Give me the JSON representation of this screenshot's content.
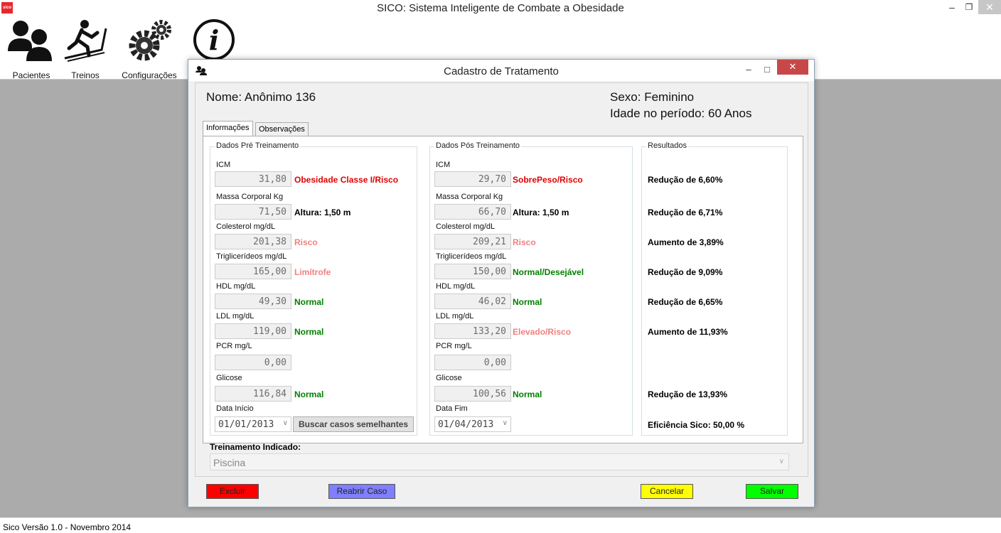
{
  "app": {
    "title": "SICO: Sistema Inteligente de Combate a Obesidade",
    "icon_text": "sico",
    "controls": {
      "minimize": "–",
      "restore": "❐",
      "close": "✕"
    }
  },
  "toolbar": {
    "items": [
      {
        "label": "Pacientes",
        "icon": "patients-icon"
      },
      {
        "label": "Treinos",
        "icon": "treadmill-icon"
      },
      {
        "label": "Configurações",
        "icon": "gears-icon"
      },
      {
        "label": "",
        "icon": "info-icon"
      }
    ]
  },
  "status": {
    "text": "Sico Versão 1.0 - Novembro 2014"
  },
  "dialog": {
    "title": "Cadastro de Tratamento",
    "controls": {
      "minimize": "–",
      "maximize": "□",
      "close": "✕"
    },
    "patient": {
      "name": "Nome: Anônimo 136",
      "sex": "Sexo: Feminino",
      "age": "Idade no período: 60 Anos"
    },
    "tabs": [
      {
        "label": "Informações",
        "active": true
      },
      {
        "label": "Observações",
        "active": false
      }
    ],
    "pre": {
      "title": "Dados Pré Treinamento",
      "fields": [
        {
          "label": "ICM",
          "value": "31,80",
          "status": "Obesidade Classe I/Risco",
          "status_color": "#e00000"
        },
        {
          "label": "Massa Corporal Kg",
          "value": "71,50",
          "status": "Altura: 1,50 m",
          "status_color": "#000000"
        },
        {
          "label": "Colesterol mg/dL",
          "value": "201,38",
          "status": "Risco",
          "status_color": "#f08080"
        },
        {
          "label": "Triglicerídeos mg/dL",
          "value": "165,00",
          "status": "Limítrofe",
          "status_color": "#f08080"
        },
        {
          "label": "HDL mg/dL",
          "value": "49,30",
          "status": "Normal",
          "status_color": "#008000"
        },
        {
          "label": "LDL mg/dL",
          "value": "119,00",
          "status": "Normal",
          "status_color": "#008000"
        },
        {
          "label": "PCR mg/L",
          "value": "0,00",
          "status": "",
          "status_color": "#000000"
        },
        {
          "label": "Glicose",
          "value": "116,84",
          "status": "Normal",
          "status_color": "#008000"
        }
      ],
      "date_label": "Data Início",
      "date_value": "01/01/2013",
      "search_button": "Buscar casos semelhantes"
    },
    "post": {
      "title": "Dados Pós Treinamento",
      "fields": [
        {
          "label": "ICM",
          "value": "29,70",
          "status": "SobrePeso/Risco",
          "status_color": "#e00000"
        },
        {
          "label": "Massa Corporal Kg",
          "value": "66,70",
          "status": "Altura: 1,50 m",
          "status_color": "#000000"
        },
        {
          "label": "Colesterol mg/dL",
          "value": "209,21",
          "status": "Risco",
          "status_color": "#f08080"
        },
        {
          "label": "Triglicerídeos mg/dL",
          "value": "150,00",
          "status": "Normal/Desejável",
          "status_color": "#008000"
        },
        {
          "label": "HDL mg/dL",
          "value": "46,02",
          "status": "Normal",
          "status_color": "#008000"
        },
        {
          "label": "LDL mg/dL",
          "value": "133,20",
          "status": "Elevado/Risco",
          "status_color": "#f08080"
        },
        {
          "label": "PCR mg/L",
          "value": "0,00",
          "status": "",
          "status_color": "#000000"
        },
        {
          "label": "Glicose",
          "value": "100,56",
          "status": "Normal",
          "status_color": "#008000"
        }
      ],
      "date_label": "Data Fim",
      "date_value": "01/04/2013"
    },
    "results": {
      "title": "Resultados",
      "items": [
        "Redução de 6,60%",
        "Redução de 6,71%",
        "Aumento de 3,89%",
        "Redução de 9,09%",
        "Redução de 6,65%",
        "Aumento de 11,93%",
        "",
        "Redução de 13,93%"
      ],
      "efficiency": "Eficiência Sico: 50,00 %"
    },
    "training_label": "Treinamento Indicado:",
    "training_value": "Piscina",
    "buttons": {
      "delete": {
        "label": "Excluir",
        "color": "#ff0000"
      },
      "reopen": {
        "label": "Reabrir Caso",
        "color": "#8080ff"
      },
      "cancel": {
        "label": "Cancelar",
        "color": "#ffff00"
      },
      "save": {
        "label": "Salvar",
        "color": "#00ff00"
      }
    }
  }
}
